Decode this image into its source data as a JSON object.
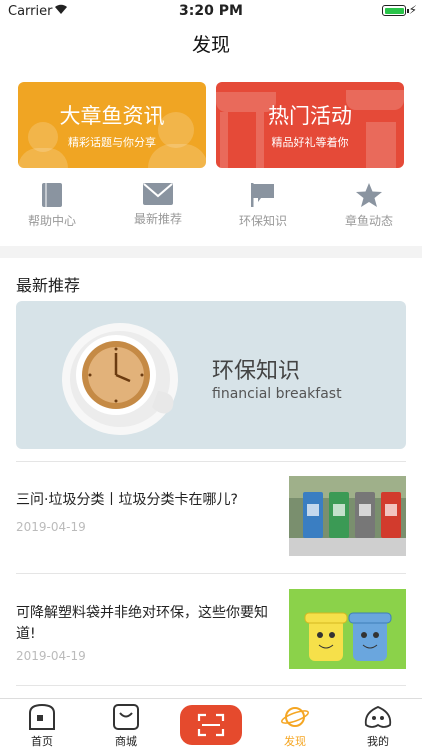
{
  "status_bar": {
    "carrier": "Carrier",
    "time": "3:20 PM"
  },
  "nav": {
    "title": "发现"
  },
  "banners": [
    {
      "title": "大章鱼资讯",
      "subtitle": "精彩话题与你分享",
      "color": "#f0a523"
    },
    {
      "title": "热门活动",
      "subtitle": "精品好礼等着你",
      "color": "#e54a38"
    }
  ],
  "quick_links": [
    {
      "label": "帮助中心",
      "icon": "book-icon"
    },
    {
      "label": "最新推荐",
      "icon": "mail-icon"
    },
    {
      "label": "环保知识",
      "icon": "flag-icon"
    },
    {
      "label": "章鱼动态",
      "icon": "star-icon"
    }
  ],
  "section": {
    "title": "最新推荐"
  },
  "feature": {
    "title": "环保知识",
    "subtitle": "financial breakfast"
  },
  "articles": [
    {
      "title": "三问·垃圾分类丨垃圾分类卡在哪儿?",
      "date": "2019-04-19"
    },
    {
      "title": "可降解塑料袋并非绝对环保，这些你要知道!",
      "date": "2019-04-19"
    }
  ],
  "tabs": [
    {
      "label": "首页",
      "icon": "home-icon"
    },
    {
      "label": "商城",
      "icon": "shop-icon"
    },
    {
      "label": "",
      "icon": "scan-icon"
    },
    {
      "label": "发现",
      "icon": "planet-icon"
    },
    {
      "label": "我的",
      "icon": "octopus-icon"
    }
  ],
  "colors": {
    "accent": "#f5a623",
    "scan": "#e54a2d",
    "banner_orange": "#f0a523",
    "banner_red": "#e54a38"
  }
}
